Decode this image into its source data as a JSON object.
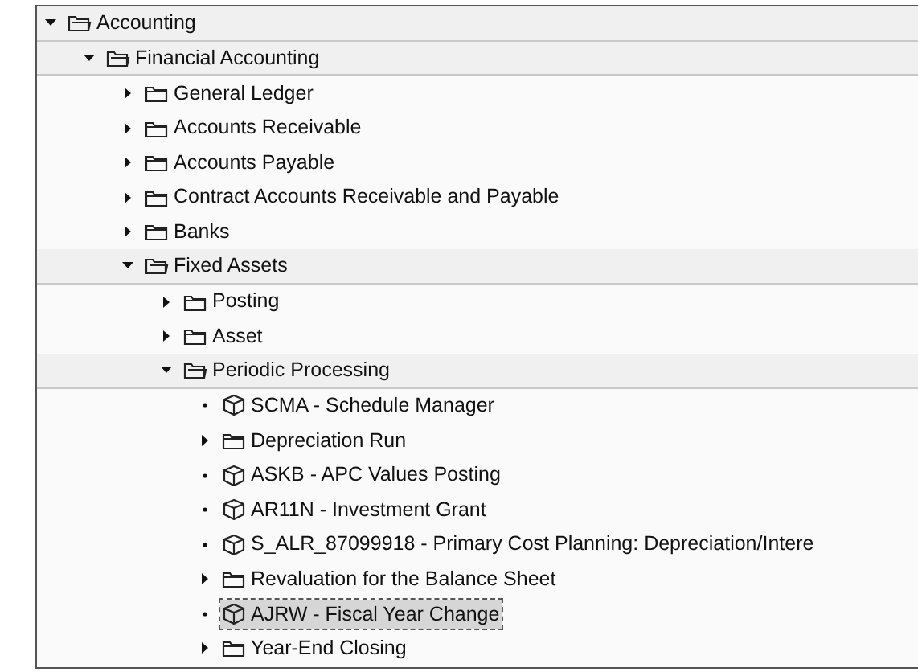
{
  "tree": [
    {
      "label": "Accounting",
      "kind": "folder",
      "expanded": true,
      "selected": false,
      "children": [
        {
          "label": "Financial Accounting",
          "kind": "folder",
          "expanded": true,
          "selected": false,
          "children": [
            {
              "label": "General Ledger",
              "kind": "folder",
              "expanded": false,
              "selected": false
            },
            {
              "label": "Accounts Receivable",
              "kind": "folder",
              "expanded": false,
              "selected": false
            },
            {
              "label": "Accounts Payable",
              "kind": "folder",
              "expanded": false,
              "selected": false
            },
            {
              "label": "Contract Accounts Receivable and Payable",
              "kind": "folder",
              "expanded": false,
              "selected": false
            },
            {
              "label": "Banks",
              "kind": "folder",
              "expanded": false,
              "selected": false
            },
            {
              "label": "Fixed Assets",
              "kind": "folder",
              "expanded": true,
              "selected": false,
              "children": [
                {
                  "label": "Posting",
                  "kind": "folder",
                  "expanded": false,
                  "selected": false
                },
                {
                  "label": "Asset",
                  "kind": "folder",
                  "expanded": false,
                  "selected": false
                },
                {
                  "label": "Periodic Processing",
                  "kind": "folder",
                  "expanded": true,
                  "selected": false,
                  "children": [
                    {
                      "label": "SCMA - Schedule Manager",
                      "kind": "transaction",
                      "selected": false
                    },
                    {
                      "label": "Depreciation Run",
                      "kind": "folder",
                      "expanded": false,
                      "selected": false
                    },
                    {
                      "label": "ASKB - APC Values Posting",
                      "kind": "transaction",
                      "selected": false
                    },
                    {
                      "label": "AR11N - Investment Grant",
                      "kind": "transaction",
                      "selected": false
                    },
                    {
                      "label": "S_ALR_87099918 - Primary Cost Planning: Depreciation/Intere",
                      "kind": "transaction",
                      "selected": false
                    },
                    {
                      "label": "Revaluation for the Balance Sheet",
                      "kind": "folder",
                      "expanded": false,
                      "selected": false
                    },
                    {
                      "label": "AJRW - Fiscal Year Change",
                      "kind": "transaction",
                      "selected": true
                    },
                    {
                      "label": "Year-End Closing",
                      "kind": "folder",
                      "expanded": false,
                      "selected": false
                    }
                  ]
                }
              ]
            }
          ]
        }
      ]
    }
  ]
}
